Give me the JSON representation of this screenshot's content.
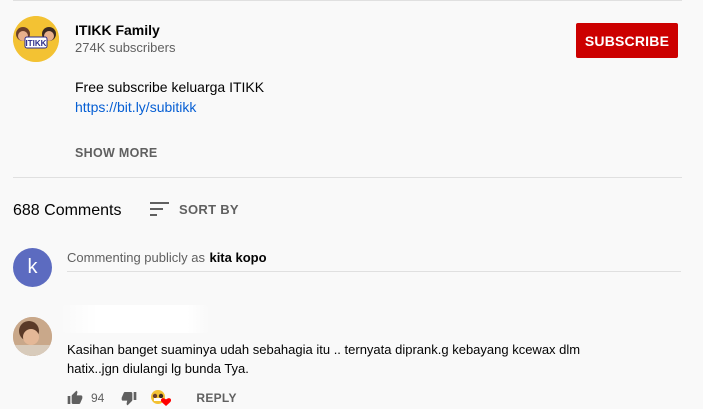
{
  "channel": {
    "name": "ITIKK Family",
    "subscribers": "274K subscribers",
    "logo_text": "ITIKK",
    "subscribe_label": "SUBSCRIBE"
  },
  "description": {
    "text": "Free subscribe keluarga ITIKK",
    "link": "https://bit.ly/subitikk",
    "show_more": "SHOW MORE"
  },
  "comments_header": {
    "count": "688 Comments",
    "sort_label": "SORT BY"
  },
  "comment_input": {
    "prefix": "Commenting publicly as",
    "username": "kita kopo",
    "avatar_letter": "k"
  },
  "comments": [
    {
      "text": "Kasihan banget suaminya udah sebahagia itu .. ternyata diprank.g kebayang kcewax dlm hatix..jgn diulangi lg bunda Tya.",
      "likes": "94",
      "reply_label": "REPLY"
    }
  ],
  "colors": {
    "subscribe": "#cc0000",
    "link": "#065fd4",
    "user_avatar": "#5c6bc0",
    "heart": "#ff0000"
  }
}
